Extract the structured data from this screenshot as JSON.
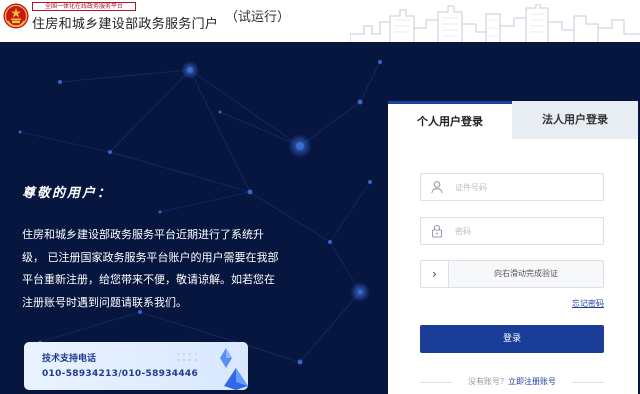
{
  "header": {
    "platform_badge": "全国一体化在线政务服务平台",
    "portal_title": "住房和城乡建设部政务服务门户",
    "portal_suffix": "（试运行）"
  },
  "notice": {
    "heading": "尊敬的用户：",
    "body_lines": [
      "住房和城乡建设部政务服务平台近期进行了系统升",
      "级，  已注册国家政务服务平台账户的用户需要在我部",
      "平台重新注册，给您带来不便，敬请谅解。如若您在",
      "注册账号时遇到问题请联系我们。"
    ]
  },
  "support": {
    "label": "技术支持电话",
    "phone": "010-58934213/010-58934446"
  },
  "login": {
    "tabs": [
      {
        "label": "个人用户登录",
        "active": true
      },
      {
        "label": "法人用户登录",
        "active": false
      }
    ],
    "id_field": {
      "placeholder": "证件号码",
      "value": "",
      "icon": "user-icon"
    },
    "password_field": {
      "placeholder": "密码",
      "value": "",
      "icon": "lock-icon"
    },
    "slider": {
      "handle_icon": "chevron-right-icon",
      "text": "向右滑动完成验证"
    },
    "forgot_password": "忘记密码",
    "login_button": "登录",
    "register_prompt": "没有账号？",
    "register_link": "立即注册账号"
  },
  "colors": {
    "background": "#06163f",
    "accent": "#1a3d9a",
    "tab_inactive": "#e8ecf3",
    "emblem_red": "#c8161d",
    "emblem_gold": "#f2c230"
  }
}
